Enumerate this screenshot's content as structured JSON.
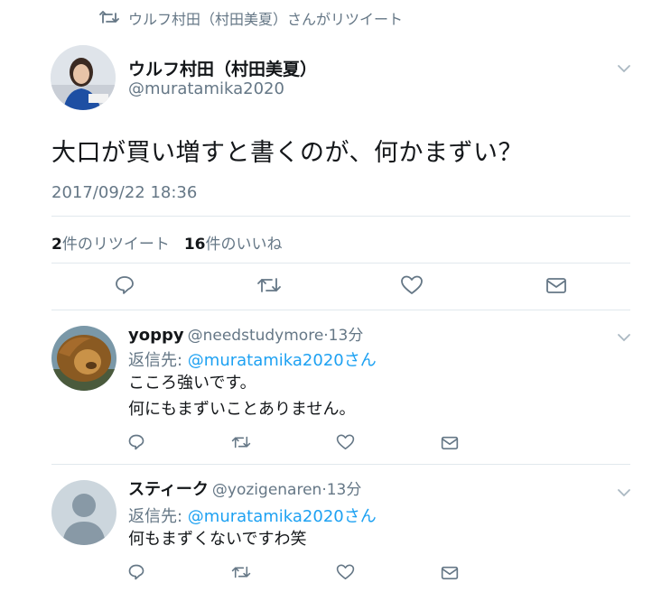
{
  "retweet_context": {
    "text": "ウルフ村田（村田美夏）さんがリツイート"
  },
  "main_tweet": {
    "author_name": "ウルフ村田（村田美夏）",
    "author_handle": "@muratamika2020",
    "text": "大口が買い増すと書くのが、何かまずい？",
    "timestamp": "2017/09/22 18:36",
    "retweet_count": "2",
    "retweet_label": "件のリツイート",
    "like_count": "16",
    "like_label": "件のいいね"
  },
  "replies": [
    {
      "name": "yoppy",
      "handle": "@needstudymore",
      "time": "·13分",
      "reply_to_label": "返信先: ",
      "reply_to_mention": "@muratamika2020さん",
      "text_line1": "こころ強いです。",
      "text_line2": "何にもまずいことありません。"
    },
    {
      "name": "スティーク",
      "handle": "@yozigenaren",
      "time": "·13分",
      "reply_to_label": "返信先: ",
      "reply_to_mention": "@muratamika2020さん",
      "text_line1": "何もまずくないですわ笑"
    }
  ],
  "colors": {
    "text": "#14171a",
    "secondary": "#657786",
    "link": "#1da1f2",
    "divider": "#e1e8ed"
  },
  "icons": [
    "retweet-icon",
    "chevron-down-icon",
    "reply-icon",
    "like-icon",
    "dm-icon"
  ]
}
